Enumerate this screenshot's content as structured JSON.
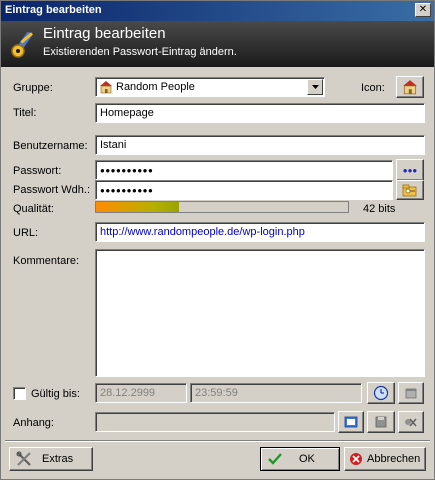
{
  "window": {
    "title": "Eintrag bearbeiten",
    "close_glyph": "✕"
  },
  "header": {
    "title": "Eintrag bearbeiten",
    "subtitle": "Existierenden Passwort-Eintrag ändern.",
    "icon": "key-pencil-icon"
  },
  "form": {
    "group": {
      "label": "Gruppe:",
      "value": "Random People"
    },
    "icon_label": "Icon:",
    "title": {
      "label": "Titel:",
      "value": "Homepage"
    },
    "username": {
      "label": "Benutzername:",
      "value": "Istani"
    },
    "password": {
      "label": "Passwort:",
      "value": "●●●●●●●●●●",
      "reveal_glyph": "●●●"
    },
    "password_repeat": {
      "label": "Passwort Wdh.:",
      "value": "●●●●●●●●●●"
    },
    "quality": {
      "label": "Qualität:",
      "value_text": "42 bits",
      "fraction": 0.33
    },
    "url": {
      "label": "URL:",
      "value": "http://www.randompeople.de/wp-login.php"
    },
    "comments": {
      "label": "Kommentare:",
      "value": ""
    },
    "expires": {
      "label": "Gültig bis:",
      "date": "28.12.2999",
      "time": "23:59:59",
      "checked": false
    },
    "attachment": {
      "label": "Anhang:",
      "value": ""
    }
  },
  "buttons": {
    "tools": "Extras",
    "ok": "OK",
    "cancel": "Abbrechen"
  },
  "colors": {
    "url_text": "#0000cc",
    "quality_start": "#ff8c00",
    "quality_end": "#9aa300",
    "header_bg": "#2a2a2a"
  }
}
